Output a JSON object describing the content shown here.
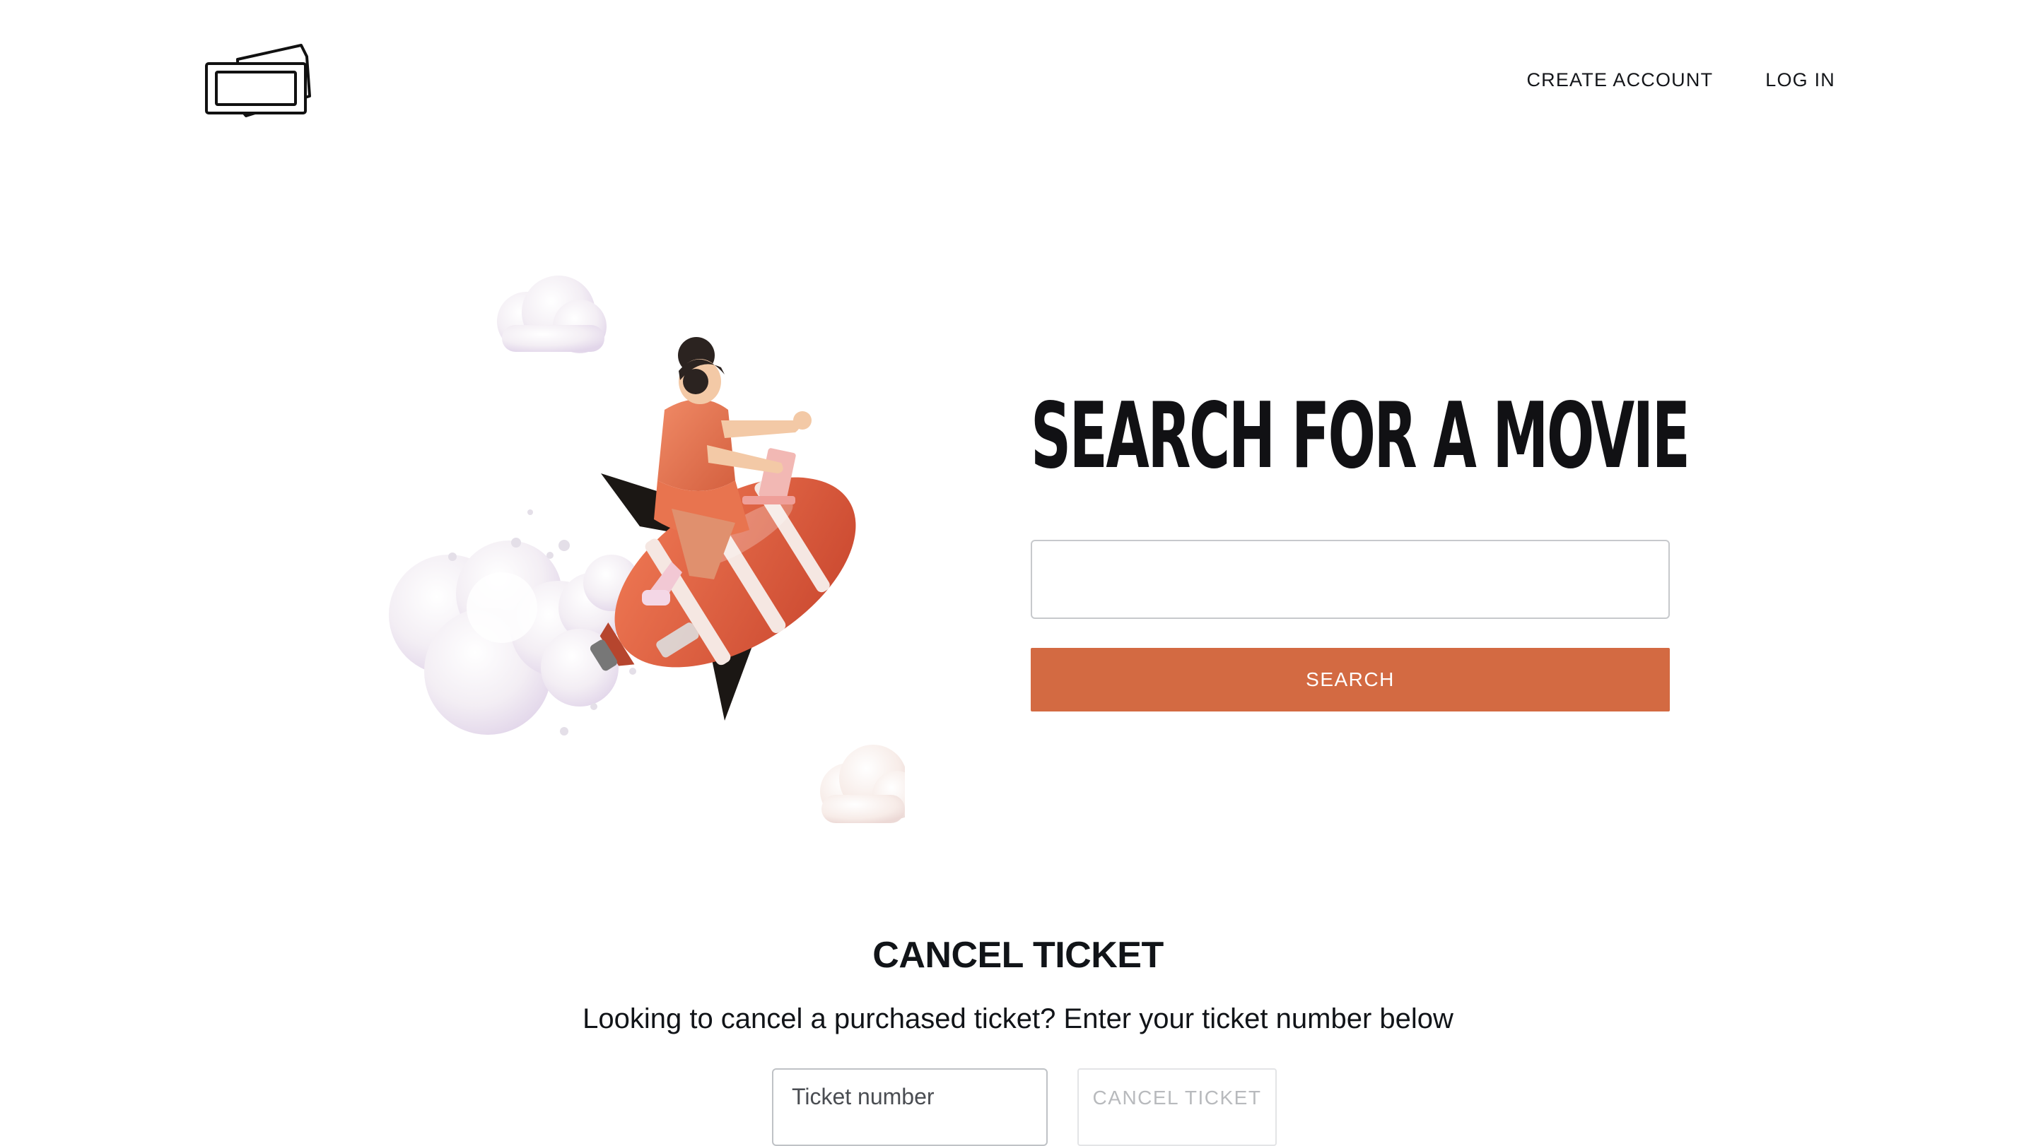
{
  "brand": {
    "logo_icon": "ticket-logo-icon"
  },
  "nav": {
    "create_account": "CREATE ACCOUNT",
    "log_in": "LOG IN"
  },
  "search": {
    "title": "SEARCH FOR A MOVIE",
    "input_value": "",
    "placeholder": "",
    "button_label": "SEARCH"
  },
  "cancel": {
    "title": "CANCEL TICKET",
    "description": "Looking to cancel a purchased ticket? Enter your ticket number below",
    "input_placeholder": "Ticket number",
    "button_label": "CANCEL TICKET"
  },
  "colors": {
    "accent": "#d36a42",
    "text": "#111418",
    "background": "#ffffff"
  }
}
